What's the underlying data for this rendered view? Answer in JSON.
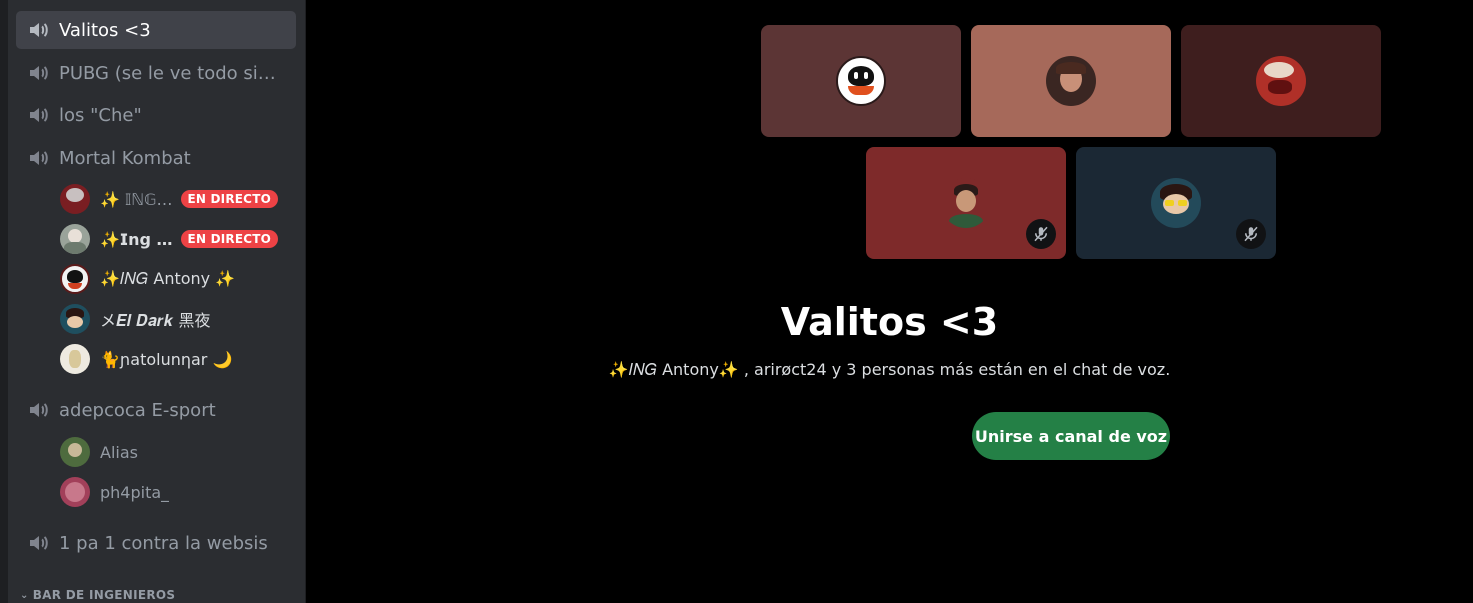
{
  "sidebar": {
    "channels": [
      {
        "name": "Valitos <3",
        "active": true
      },
      {
        "name": "PUBG (se le ve todo sin …",
        "active": false
      },
      {
        "name": "los \"Che\"",
        "active": false
      },
      {
        "name": "Mortal Kombat",
        "active": false
      },
      {
        "name": "adepcoca E-sport",
        "active": false
      },
      {
        "name": "1 pa 1 contra la websis",
        "active": false
      }
    ],
    "mortal_kombat_members": [
      {
        "name": "✨ 𝕀ℕ𝔾…",
        "live_label": "EN DIRECTO",
        "avatar_color": "#7a1e22"
      },
      {
        "name": "✨𝗜𝗻𝗴 …",
        "live_label": "EN DIRECTO",
        "avatar_color": "#9aa39a"
      },
      {
        "name": "✨𝐼𝑁𝐺 Antony ✨",
        "avatar_color": "#f2f2f2"
      },
      {
        "name": "メ𝑬𝒍 𝑫𝒂𝒓𝒌 黑夜",
        "avatar_color": "#1f4f5f"
      },
      {
        "name": "🐈ɲatolunηar 🌙",
        "avatar_color": "#eeeae0"
      }
    ],
    "adepcoca_members": [
      {
        "name": "Alias",
        "avatar_color": "#4e6b3e"
      },
      {
        "name": "ph4pita_",
        "avatar_color": "#a2405a"
      }
    ],
    "category": "BAR DE INGENIEROS"
  },
  "main": {
    "tiles": [
      {
        "bg": "#5c3535",
        "avatar_color": "#ffffff",
        "muted": false
      },
      {
        "bg": "#a6695a",
        "avatar_color": "#3a2622",
        "muted": false
      },
      {
        "bg": "#3e1e1e",
        "avatar_color": "#b03028",
        "muted": false
      },
      {
        "bg": "#7e2a2a",
        "avatar_color": "#8a3a2a",
        "muted": true
      },
      {
        "bg": "#1b2834",
        "avatar_color": "#234a5a",
        "muted": true
      }
    ],
    "title": "Valitos <3",
    "subtitle": "✨𝐼𝑁𝐺 Antony✨ , arirøct24 y 3 personas más están en el chat de voz.",
    "join_button": "Unirse a canal de voz"
  },
  "colors": {
    "sidebar_bg": "#2b2d31",
    "live_badge": "#ed4245",
    "join_button": "#248046",
    "text_muted": "#949ba4"
  },
  "icons": {
    "speaker": "speaker-icon",
    "mute": "mic-muted-icon",
    "chevron": "chevron-down-icon"
  }
}
